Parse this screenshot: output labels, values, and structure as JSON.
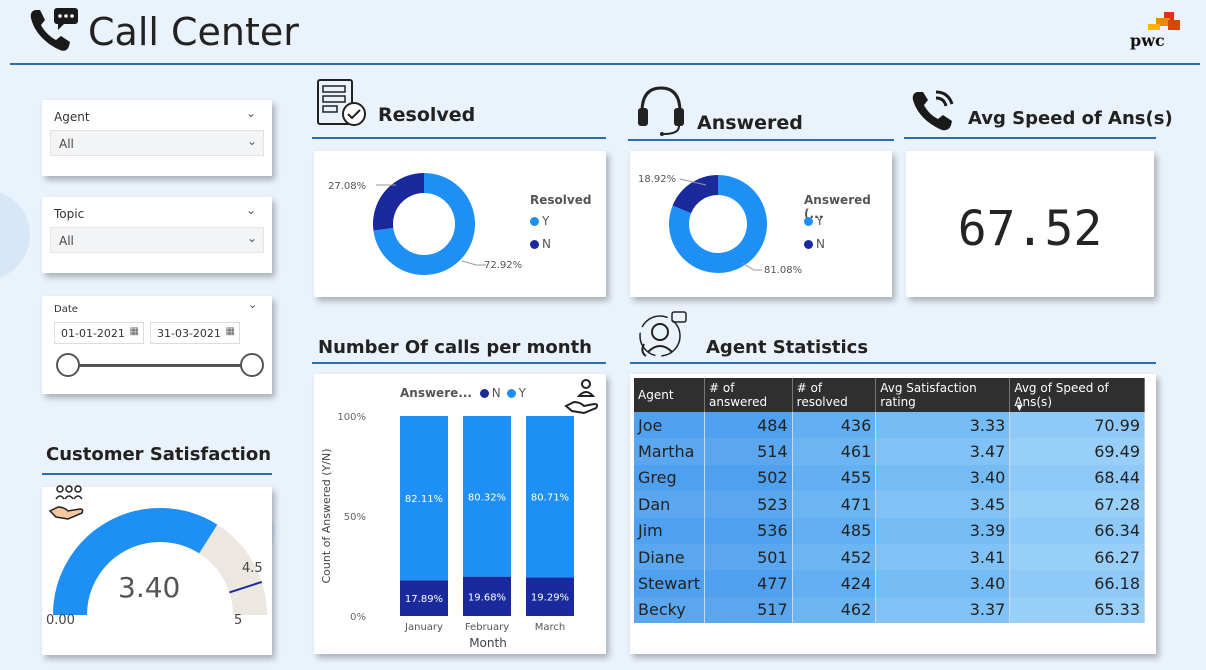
{
  "header": {
    "title": "Call Center",
    "logo_text": "pwc"
  },
  "colors": {
    "primary_blue": "#1e8ff5",
    "dark_navy": "#1a2a9c",
    "gauge_remaining": "#ece7e1",
    "accent_line": "#2b6fb3"
  },
  "slicers": {
    "agent": {
      "label": "Agent",
      "value": "All"
    },
    "topic": {
      "label": "Topic",
      "value": "All"
    },
    "date": {
      "label": "Date",
      "start": "01-01-2021",
      "end": "31-03-2021"
    }
  },
  "satisfaction": {
    "title": "Customer Satisfaction",
    "value_label": "3.40",
    "min_label": "0.00",
    "max_label": "5",
    "target_label": "4.5",
    "value": 3.4,
    "min": 0,
    "max": 5,
    "target": 4.5
  },
  "resolved": {
    "title": "Resolved",
    "legend_title": "Resolved",
    "legend_y": "Y",
    "legend_n": "N",
    "y_pct": 72.92,
    "n_pct": 27.08,
    "y_label": "72.92%",
    "n_label": "27.08%"
  },
  "answered": {
    "title": "Answered",
    "legend_title": "Answered (...",
    "legend_y": "Y",
    "legend_n": "N",
    "y_pct": 81.08,
    "n_pct": 18.92,
    "y_label": "81.08%",
    "n_label": "18.92%"
  },
  "avg_speed": {
    "title": "Avg Speed of Ans(s)",
    "value": "67.52"
  },
  "calls_chart": {
    "title": "Number Of calls per month",
    "legend_title": "Answere...",
    "legend_n": "N",
    "legend_y": "Y"
  },
  "chart_data": {
    "type": "bar",
    "stacked": true,
    "percent_stacked": true,
    "categories": [
      "January",
      "February",
      "March"
    ],
    "series": [
      {
        "name": "N",
        "values": [
          17.89,
          19.68,
          19.29
        ],
        "labels": [
          "17.89%",
          "19.68%",
          "19.29%"
        ],
        "color": "#1a2a9c"
      },
      {
        "name": "Y",
        "values": [
          82.11,
          80.32,
          80.71
        ],
        "labels": [
          "82.11%",
          "80.32%",
          "80.71%"
        ],
        "color": "#1e8ff5"
      }
    ],
    "yticks": [
      "0%",
      "50%",
      "100%"
    ],
    "xlabel": "Month",
    "ylabel": "Count of Answered (Y/N)",
    "ylim": [
      0,
      100
    ],
    "legend_position": "top"
  },
  "agent_stats": {
    "title": "Agent Statistics",
    "columns": [
      "Agent",
      "# of answered",
      "# of resolved",
      "Avg Satisfaction rating",
      "Avg of Speed of Ans(s)"
    ],
    "rows": [
      [
        "Joe",
        "484",
        "436",
        "3.33",
        "70.99"
      ],
      [
        "Martha",
        "514",
        "461",
        "3.47",
        "69.49"
      ],
      [
        "Greg",
        "502",
        "455",
        "3.40",
        "68.44"
      ],
      [
        "Dan",
        "523",
        "471",
        "3.45",
        "67.28"
      ],
      [
        "Jim",
        "536",
        "485",
        "3.39",
        "66.34"
      ],
      [
        "Diane",
        "501",
        "452",
        "3.41",
        "66.27"
      ],
      [
        "Stewart",
        "477",
        "424",
        "3.40",
        "66.18"
      ],
      [
        "Becky",
        "517",
        "462",
        "3.37",
        "65.33"
      ]
    ]
  }
}
